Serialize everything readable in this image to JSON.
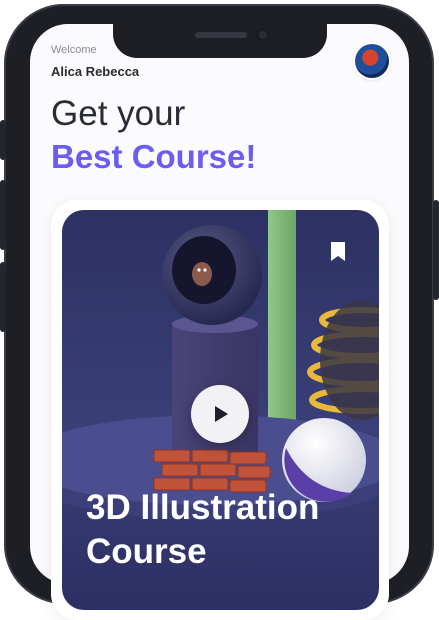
{
  "header": {
    "welcome": "Welcome",
    "user_name": "Alica Rebecca"
  },
  "hero": {
    "line1": "Get your",
    "line2": "Best Course!"
  },
  "course": {
    "title_line1": "3D Illustration",
    "title_line2": "Course",
    "bookmark_icon": "bookmark-icon",
    "play_icon": "play-icon"
  },
  "colors": {
    "accent": "#6c5cf0",
    "text_dark": "#2a2c35",
    "card_bg": "#2d3163"
  }
}
